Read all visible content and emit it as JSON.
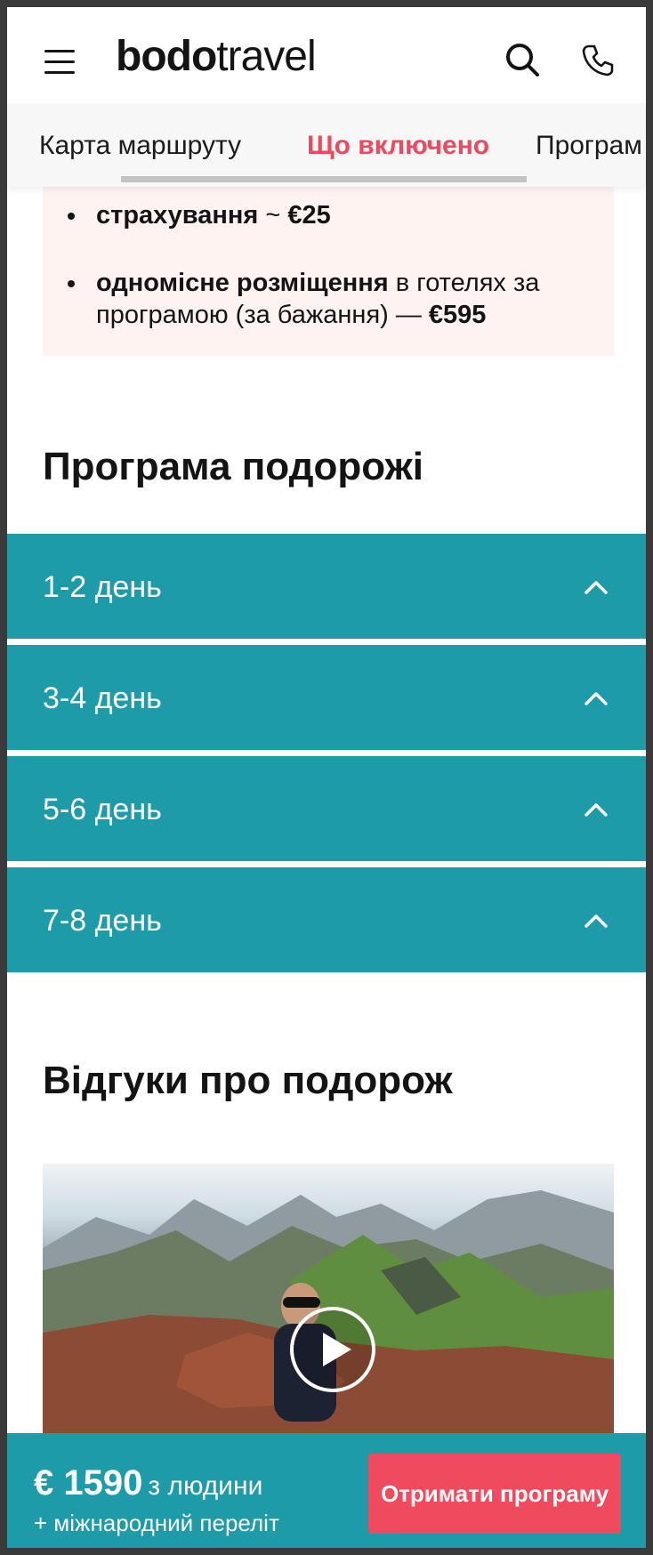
{
  "header": {
    "logo_bold": "bodo",
    "logo_regular": "travel",
    "icons": [
      "menu-icon",
      "search-icon",
      "phone-icon"
    ]
  },
  "tabs": [
    {
      "label": "Карта маршруту",
      "active": false
    },
    {
      "label": "Що включено",
      "active": true
    },
    {
      "label": "Програм",
      "active": false
    }
  ],
  "extras": {
    "items": [
      {
        "bold": "страхування",
        "text": " ~ ",
        "price": "€25"
      },
      {
        "bold": "одномісне розміщення",
        "text": " в готелях за програмою (за бажання) — ",
        "price": "€595"
      }
    ]
  },
  "program": {
    "title": "Програма подорожі",
    "days": [
      {
        "label": "1-2 день"
      },
      {
        "label": "3-4 день"
      },
      {
        "label": "5-6 день"
      },
      {
        "label": "7-8 день"
      }
    ]
  },
  "reviews": {
    "title": "Відгуки про подорож",
    "video_icon": "play-icon"
  },
  "bottom_bar": {
    "price": "€ 1590",
    "per": "з людини",
    "flight_note": "+ міжнародний переліт",
    "cta": "Отримати програму"
  },
  "colors": {
    "accent_teal": "#1d9ba8",
    "accent_red": "#ec4a5e",
    "extras_bg": "#fff3f2"
  }
}
